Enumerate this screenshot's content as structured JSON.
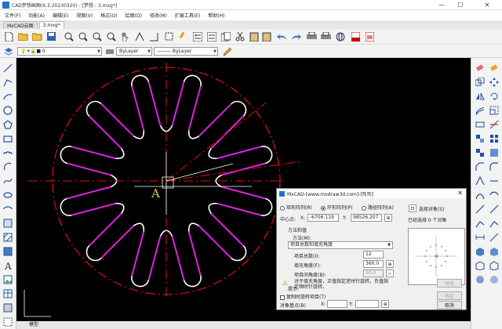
{
  "window": {
    "title": "CAD梦想画图(6.3.20230320) - [梦想 - 3.mxg*]",
    "minimize": "—",
    "maximize": "☐",
    "close": "✕"
  },
  "menu": [
    "文件(F)",
    "功能(A)",
    "编辑(E)",
    "视图(V)",
    "格式(O)",
    "绘图(D)",
    "修改(M)",
    "扩展工具(E)",
    "帮助(H)"
  ],
  "tabs": [
    {
      "label": "MxCAD云图",
      "active": false
    },
    {
      "label": "3.mxg*",
      "active": true
    }
  ],
  "layer": {
    "current": "0",
    "color": "ByLayer",
    "linetype": "ByLayer"
  },
  "canvas": {
    "label_A": "A"
  },
  "model_tab": "模型",
  "dialog": {
    "title": "MxCAD-[www.mxdraw3d.com]-[阵列]",
    "close": "✕",
    "radio_rect": "矩形阵列(R)",
    "radio_polar": "环形阵列(P)",
    "radio_path": "路径阵列(A)",
    "select_objects": "选择对象(S)",
    "selected_count": "已经选择 0 个对象",
    "center_label": "中心点:",
    "x_label": "X:",
    "x_value": "-6706.119",
    "y_label": "Y:",
    "y_value": "98526.207",
    "method_group": "方法和值",
    "method_label": "方法(M):",
    "method_value": "项目总数和填充角度",
    "total_label": "项目总数(I):",
    "total_value": "12",
    "fill_label": "填充角度(F):",
    "fill_value": "360.0",
    "between_label": "项目间角度(B):",
    "between_value": "30.0",
    "tip_text": "对于填充角度，正值指定逆时针旋转，负值指定顺时针旋转。",
    "tip_label": "提示",
    "rotate_check": "复制时旋转项目(T)",
    "base_label": "对象基点(B)",
    "base_x_label": "X:",
    "base_y_label": "Y:",
    "preview_button": "预览",
    "ok_button": "确定",
    "cancel_button": "取消"
  },
  "colors": {
    "canvas_bg": "#000000",
    "dashdot": "#e01010",
    "slot_magenta": "#e020e0",
    "slot_white": "#ffffff",
    "label_yellow": "#e0d020"
  }
}
